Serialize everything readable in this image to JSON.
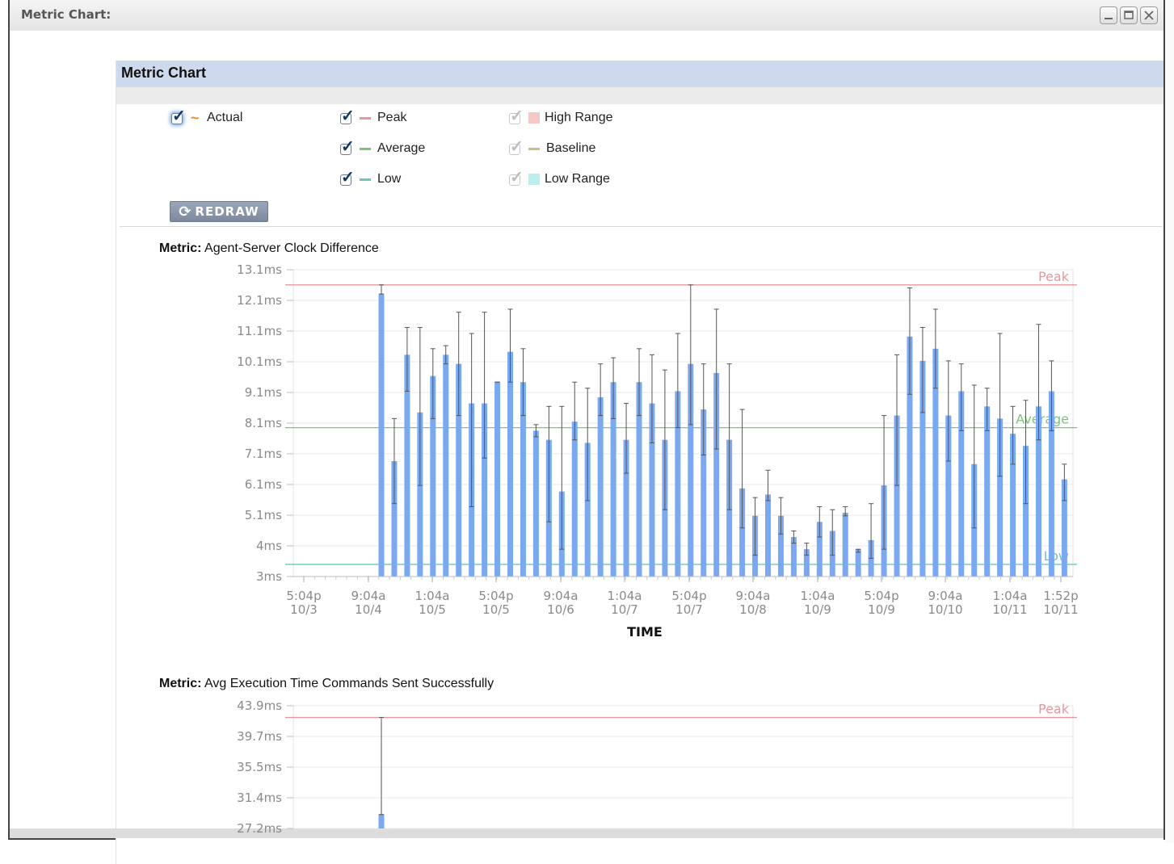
{
  "window": {
    "title": "Metric Chart:",
    "buttons": [
      "minimize",
      "maximize",
      "close"
    ]
  },
  "panel": {
    "title": "Metric Chart",
    "redraw_label": "REDRAW",
    "redraw_icon": "refresh-icon"
  },
  "legend": [
    {
      "label": "Actual",
      "checked": true,
      "enabled": true,
      "swatch": "tilde",
      "color": "#f08a24"
    },
    {
      "label": "Peak",
      "checked": true,
      "enabled": true,
      "swatch": "line",
      "color": "#e8989a"
    },
    {
      "label": "Average",
      "checked": true,
      "enabled": true,
      "swatch": "line",
      "color": "#7cc47c"
    },
    {
      "label": "Low",
      "checked": true,
      "enabled": true,
      "swatch": "line",
      "color": "#6fc7b8"
    },
    {
      "label": "High Range",
      "checked": true,
      "enabled": false,
      "swatch": "box",
      "color": "#f6c8c8"
    },
    {
      "label": "Baseline",
      "checked": true,
      "enabled": false,
      "swatch": "line",
      "color": "#cdbf82"
    },
    {
      "label": "Low Range",
      "checked": true,
      "enabled": false,
      "swatch": "box",
      "color": "#bdeeee"
    }
  ],
  "metrics": [
    {
      "prefix": "Metric:",
      "name": "Agent-Server Clock Difference"
    },
    {
      "prefix": "Metric:",
      "name": "Avg Execution Time Commands Sent Successfully"
    }
  ],
  "chart_data": [
    {
      "type": "bar",
      "title": "Agent-Server Clock Difference",
      "xlabel": "TIME",
      "ylabel": "",
      "ylim": [
        3,
        13.1
      ],
      "yticks": [
        "13.1ms",
        "12.1ms",
        "11.1ms",
        "10.1ms",
        "9.1ms",
        "8.1ms",
        "7.1ms",
        "6.1ms",
        "5.1ms",
        "4ms",
        "3ms"
      ],
      "xticks": [
        {
          "time": "5:04p",
          "date": "10/3"
        },
        {
          "time": "9:04a",
          "date": "10/4"
        },
        {
          "time": "1:04a",
          "date": "10/5"
        },
        {
          "time": "5:04p",
          "date": "10/5"
        },
        {
          "time": "9:04a",
          "date": "10/6"
        },
        {
          "time": "1:04a",
          "date": "10/7"
        },
        {
          "time": "5:04p",
          "date": "10/7"
        },
        {
          "time": "9:04a",
          "date": "10/8"
        },
        {
          "time": "1:04a",
          "date": "10/9"
        },
        {
          "time": "5:04p",
          "date": "10/9"
        },
        {
          "time": "9:04a",
          "date": "10/10"
        },
        {
          "time": "1:04a",
          "date": "10/11"
        },
        {
          "time": "1:52p",
          "date": "10/11"
        }
      ],
      "reference_lines": [
        {
          "name": "Peak",
          "value": 12.6,
          "color": "#e8989a"
        },
        {
          "name": "Average",
          "value": 7.9,
          "color": "#7cc47c"
        },
        {
          "name": "Low",
          "value": 3.4,
          "color": "#6fc7b8"
        }
      ],
      "bar_color": "#7aa9f1",
      "series": [
        {
          "values": [
            12.3,
            6.8,
            10.3,
            8.4,
            9.6,
            10.3,
            10.0,
            8.7,
            8.7,
            9.4,
            10.4,
            9.4,
            7.8,
            7.5,
            5.8,
            8.1,
            7.4,
            8.9,
            9.4,
            7.5,
            9.4,
            8.7,
            7.5,
            9.1,
            10.0,
            8.5,
            9.7,
            7.5,
            5.9,
            5.0,
            5.7,
            5.0,
            4.3,
            3.9,
            4.8,
            4.5,
            5.1,
            3.9,
            4.2,
            6.0,
            8.3,
            10.9,
            10.1,
            10.5,
            8.3,
            9.1,
            6.7,
            8.6,
            8.2,
            7.7,
            7.3,
            8.6,
            9.1,
            6.2
          ],
          "high": [
            12.6,
            8.2,
            11.2,
            11.2,
            10.5,
            10.6,
            11.7,
            11.0,
            11.7,
            9.4,
            11.8,
            10.5,
            8.0,
            8.6,
            8.6,
            9.4,
            9.2,
            10.0,
            10.2,
            8.7,
            10.5,
            10.3,
            9.8,
            11.0,
            12.6,
            10.0,
            11.8,
            10.0,
            8.5,
            5.6,
            6.5,
            5.6,
            4.5,
            4.1,
            5.3,
            5.2,
            5.3,
            3.9,
            5.4,
            8.3,
            10.3,
            12.5,
            11.2,
            11.8,
            10.1,
            10.0,
            9.3,
            9.2,
            11.0,
            8.6,
            8.8,
            11.3,
            10.1,
            6.7
          ],
          "low": [
            12.3,
            5.4,
            9.1,
            6.0,
            8.2,
            10.0,
            8.3,
            5.3,
            6.9,
            9.4,
            9.4,
            8.3,
            7.6,
            4.8,
            3.9,
            7.5,
            5.5,
            8.3,
            8.2,
            6.4,
            8.3,
            7.4,
            5.2,
            7.9,
            8.0,
            7.0,
            7.2,
            5.2,
            4.6,
            3.7,
            5.5,
            4.4,
            4.1,
            3.7,
            4.3,
            3.7,
            5.0,
            3.8,
            3.6,
            3.9,
            6.0,
            9.0,
            8.4,
            9.2,
            6.8,
            7.8,
            4.6,
            7.8,
            6.3,
            6.7,
            5.4,
            7.5,
            7.8,
            5.5
          ]
        }
      ]
    },
    {
      "type": "bar",
      "title": "Avg Execution Time Commands Sent Successfully",
      "xlabel": "",
      "ylabel": "",
      "ylim": [
        27.2,
        43.9
      ],
      "yticks": [
        "43.9ms",
        "39.7ms",
        "35.5ms",
        "31.4ms",
        "27.2ms"
      ],
      "reference_lines": [
        {
          "name": "Peak",
          "value": 42.3,
          "color": "#e8989a"
        }
      ],
      "bar_color": "#7aa9f1",
      "series": [
        {
          "values": [
            29.1
          ],
          "high": [
            42.3
          ],
          "low": [
            29.1
          ]
        }
      ]
    }
  ]
}
